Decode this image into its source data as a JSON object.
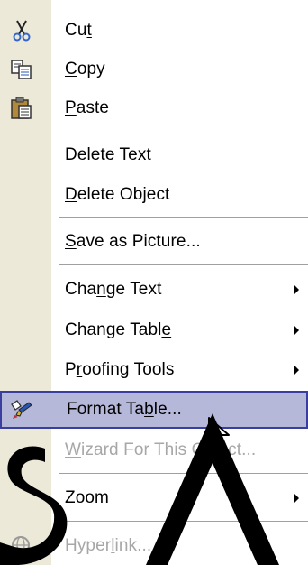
{
  "menu": {
    "items": [
      {
        "pre": "Cu",
        "acc": "t",
        "post": "",
        "icon": "scissors-icon",
        "submenu": false,
        "enabled": true
      },
      {
        "pre": "",
        "acc": "C",
        "post": "opy",
        "icon": "copy-icon",
        "submenu": false,
        "enabled": true
      },
      {
        "pre": "",
        "acc": "P",
        "post": "aste",
        "icon": "paste-icon",
        "submenu": false,
        "enabled": true
      },
      {
        "pre": "Delete Te",
        "acc": "x",
        "post": "t",
        "icon": "",
        "submenu": false,
        "enabled": true
      },
      {
        "pre": "",
        "acc": "D",
        "post": "elete Object",
        "icon": "",
        "submenu": false,
        "enabled": true
      },
      {
        "pre": "",
        "acc": "S",
        "post": "ave as Picture...",
        "icon": "",
        "submenu": false,
        "enabled": true
      },
      {
        "pre": "Cha",
        "acc": "n",
        "post": "ge Text",
        "icon": "",
        "submenu": true,
        "enabled": true
      },
      {
        "pre": "Change Tabl",
        "acc": "e",
        "post": "",
        "icon": "",
        "submenu": true,
        "enabled": true
      },
      {
        "pre": "P",
        "acc": "r",
        "post": "oofing Tools",
        "icon": "",
        "submenu": true,
        "enabled": true
      },
      {
        "pre": "Format Ta",
        "acc": "b",
        "post": "le...",
        "icon": "format-table-icon",
        "submenu": false,
        "enabled": true,
        "highlighted": true
      },
      {
        "pre": "",
        "acc": "W",
        "post": "izard For This Object...",
        "icon": "",
        "submenu": false,
        "enabled": false
      },
      {
        "pre": "",
        "acc": "Z",
        "post": "oom",
        "icon": "",
        "submenu": true,
        "enabled": true
      },
      {
        "pre": "Hyper",
        "acc": "l",
        "post": "ink...",
        "icon": "hyperlink-icon",
        "submenu": false,
        "enabled": false
      }
    ]
  },
  "colors": {
    "highlight_fill": "#b6b8da",
    "highlight_border": "#3a3e9c",
    "disabled_text": "#a7a7a7",
    "gutter": "#ece9d8"
  }
}
